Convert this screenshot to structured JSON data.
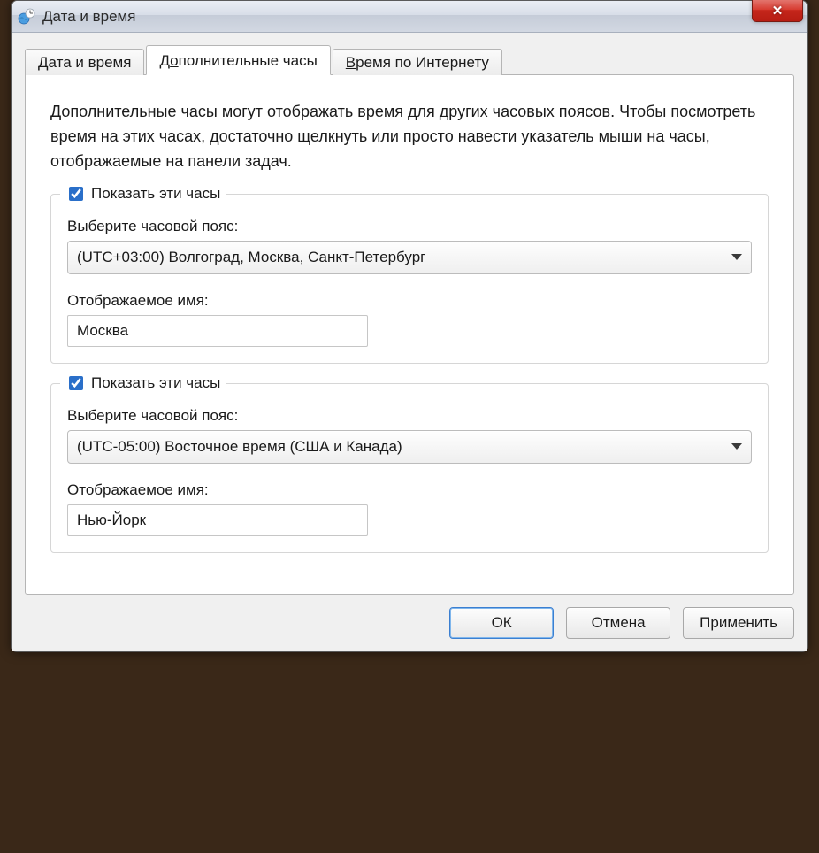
{
  "window": {
    "title": "Дата и время"
  },
  "tabs": {
    "0": {
      "label_pre": "",
      "label_u": "Д",
      "label_post": "ата и время"
    },
    "1": {
      "label_pre": "Д",
      "label_u": "о",
      "label_post": "полнительные часы"
    },
    "2": {
      "label_pre": "",
      "label_u": "В",
      "label_post": "ремя по Интернету"
    }
  },
  "description": "Дополнительные часы могут отображать время для других часовых поясов. Чтобы посмотреть время на этих часах, достаточно щелкнуть или просто навести указатель мыши на часы, отображаемые на панели задач.",
  "clock1": {
    "show_pre": "Пока",
    "show_u": "з",
    "show_post": "ать эти часы",
    "tz_label_pre": "В",
    "tz_label_u": "ы",
    "tz_label_post": "берите часовой пояс:",
    "tz_value": "(UTC+03:00) Волгоград, Москва, Санкт-Петербург",
    "name_label_pre": "Отобра",
    "name_label_u": "ж",
    "name_label_post": "аемое имя:",
    "name_value": "Москва",
    "checked": true
  },
  "clock2": {
    "show_pre": "Пока",
    "show_u": "з",
    "show_post": "ать эти часы",
    "tz_label_pre": "Вы",
    "tz_label_u": "б",
    "tz_label_post": "ерите часовой пояс:",
    "tz_value": "(UTC-05:00) Восточное время (США и Канада)",
    "name_label_pre": "",
    "name_label_u": "О",
    "name_label_post": "тображаемое имя:",
    "name_value": "Нью-Йорк",
    "checked": true
  },
  "buttons": {
    "ok": "ОК",
    "cancel_pre": "От",
    "cancel_u": "м",
    "cancel_post": "ена",
    "apply_pre": "При",
    "apply_u": "м",
    "apply_post": "енить"
  }
}
